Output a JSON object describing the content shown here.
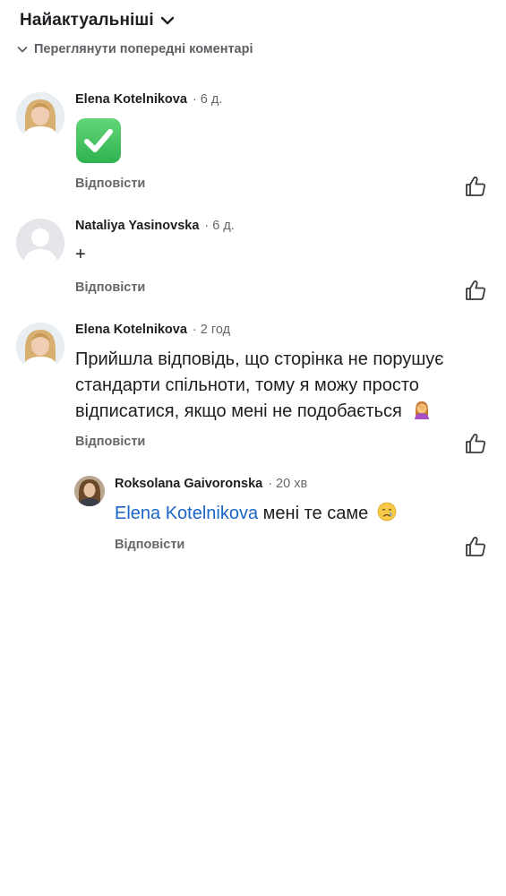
{
  "sort": {
    "label": "Найактуальніші"
  },
  "previous": {
    "label": "Переглянути попередні коментарі"
  },
  "comments": [
    {
      "author": "Elena Kotelnikova",
      "time": "· 6 д.",
      "text": "",
      "emoji": "white-heavy-check-mark",
      "reply_label": "Відповісти"
    },
    {
      "author": "Nataliya Yasinovska",
      "time": "· 6 д.",
      "text": "+",
      "reply_label": "Відповісти"
    },
    {
      "author": "Elena Kotelnikova",
      "time": "· 2 год",
      "line1": "Прийшла відповідь, що сторінка не порушує",
      "line2": "стандарти спільноти, тому я можу просто",
      "line3": "відписатися, якщо мені не подобається",
      "emoji": "woman-facepalming",
      "reply_label": "Відповісти"
    }
  ],
  "reply": {
    "author": "Roksolana Gaivoronska",
    "time": "· 20 хв",
    "mention": "Elena Kotelnikova",
    "text": " мені те саме",
    "emoji": "crying-face",
    "reply_label": "Відповісти"
  },
  "colors": {
    "link": "#1a66c8",
    "muted": "#65676b",
    "text": "#1c1e21"
  }
}
